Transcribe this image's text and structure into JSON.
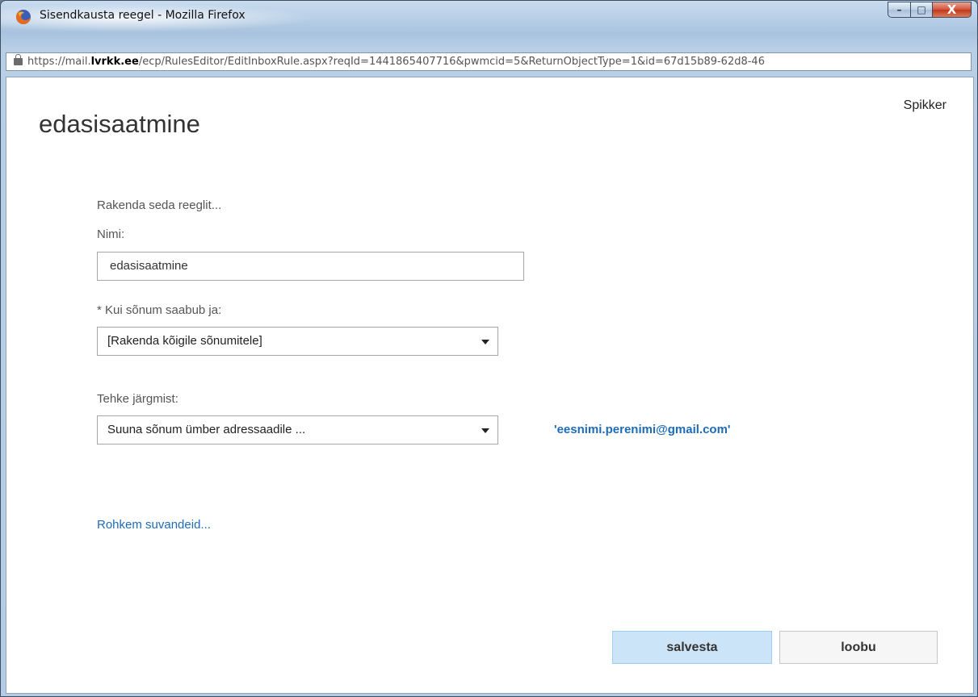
{
  "window": {
    "title": "Sisendkausta reegel - Mozilla Firefox",
    "controls": {
      "minimize": "–",
      "maximize": "□",
      "close": "X"
    }
  },
  "address_bar": {
    "url_prefix": "https://mail.",
    "url_host": "lvrkk.ee",
    "url_rest": "/ecp/RulesEditor/EditInboxRule.aspx?reqId=1441865407716&pwmcid=5&ReturnObjectType=1&id=67d15b89-62d8-46"
  },
  "page": {
    "title": "edasisaatmine",
    "help_link": "Spikker"
  },
  "form": {
    "intro": "Rakenda seda reeglit...",
    "name_label": "Nimi:",
    "name_value": "edasisaatmine",
    "condition_label": "* Kui sõnum saabub ja:",
    "condition_value": "[Rakenda kõigile sõnumitele]",
    "action_label": "Tehke järgmist:",
    "action_value": "Suuna sõnum ümber adressaadile ...",
    "action_target": "'eesnimi.perenimi@gmail.com'",
    "more_options": "Rohkem suvandeid..."
  },
  "buttons": {
    "save": "salvesta",
    "cancel": "loobu"
  },
  "colors": {
    "link": "#1e6bb8",
    "primary_button": "#cce4f7"
  }
}
